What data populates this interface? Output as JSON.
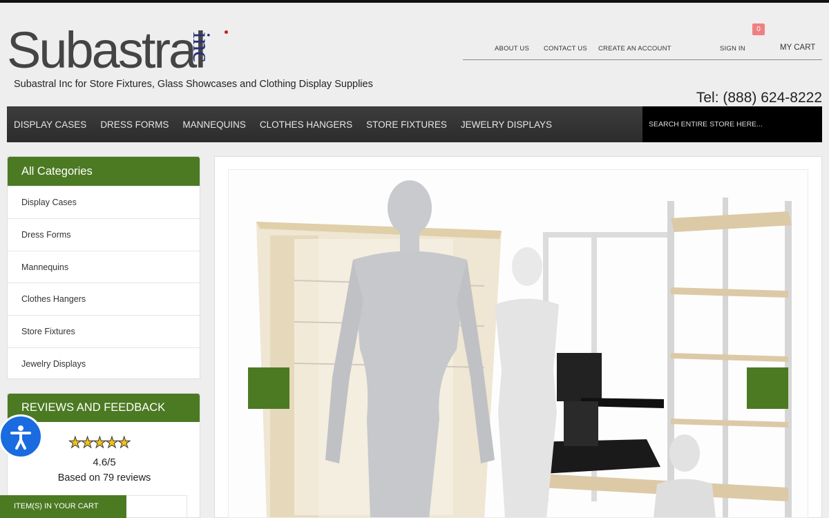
{
  "logo": {
    "brand": "Subastral",
    "suffix": "inc"
  },
  "tagline": "Subastral Inc for Store Fixtures, Glass Showcases and Clothing Display Supplies",
  "toplinks": {
    "about": "ABOUT US",
    "contact": "CONTACT US",
    "create": "CREATE AN ACCOUNT",
    "signin": "SIGN IN"
  },
  "cart": {
    "count": "0",
    "label": "MY CART"
  },
  "phone": "Tel: (888) 624-8222",
  "nav": [
    "DISPLAY CASES",
    "DRESS FORMS",
    "MANNEQUINS",
    "CLOTHES HANGERS",
    "STORE FIXTURES",
    "JEWELRY DISPLAYS"
  ],
  "search": {
    "placeholder": "SEARCH ENTIRE STORE HERE..."
  },
  "categories": {
    "title": "All Categories",
    "items": [
      "Display Cases",
      "Dress Forms",
      "Mannequins",
      "Clothes Hangers",
      "Store Fixtures",
      "Jewelry Displays"
    ]
  },
  "reviews": {
    "title": "REVIEWS AND FEEDBACK",
    "stars": "★★★★★",
    "rating": "4.6/5",
    "count_text": "Based on 79 reviews",
    "rating_value": 4.6
  },
  "cart_bar": "ITEM(S) IN YOUR CART",
  "colors": {
    "brand_green": "#4c7a23",
    "nav_dark": "#333333",
    "badge": "#f08080",
    "accessibility_blue": "#1a6be0"
  },
  "icons": {
    "accessibility": "accessibility-icon",
    "prev": "slider-prev-arrow",
    "next": "slider-next-arrow"
  }
}
